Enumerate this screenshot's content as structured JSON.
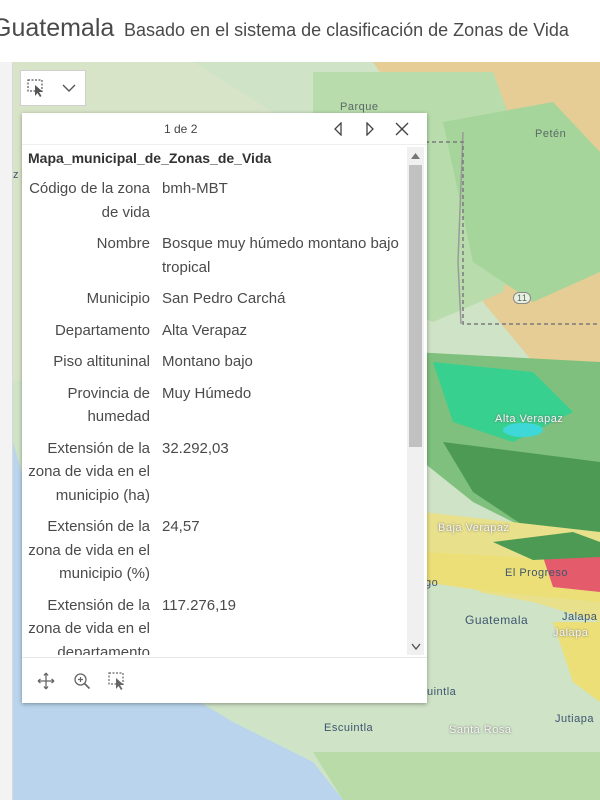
{
  "header": {
    "title": "Guatemala",
    "subtitle": "Basado en el sistema de clasificación de Zonas de Vida"
  },
  "map_tools": [
    {
      "name": "select-tool",
      "icon": "select-cursor-icon"
    },
    {
      "name": "dropdown",
      "icon": "chevron-down-icon"
    }
  ],
  "map_labels": {
    "parque": "Parque",
    "peten": "Petén",
    "route": "11",
    "alta_verapaz": "Alta Verapaz",
    "baja_verapaz": "Baja Verapaz",
    "el_progreso": "El Progreso",
    "guatemala": "Guatemala",
    "jalapa": "Jalapa",
    "jalapa2": "Jalapa",
    "escuintla": "Escuintla",
    "escuintla_partial": "uintla",
    "santa_rosa": "Santa Rosa",
    "jutiapa": "Jutiapa",
    "go_partial": "go",
    "z_partial": "z"
  },
  "popup": {
    "pager": "1 de 2",
    "title": "Mapa_municipal_de_Zonas_de_Vida",
    "attributes": [
      {
        "label": "Código de la zona de vida",
        "value": "bmh-MBT"
      },
      {
        "label": "Nombre",
        "value": "Bosque muy húmedo montano bajo tropical"
      },
      {
        "label": "Municipio",
        "value": "San Pedro Carchá"
      },
      {
        "label": "Departamento",
        "value": "Alta Verapaz"
      },
      {
        "label": "Piso altituninal",
        "value": "Montano bajo"
      },
      {
        "label": "Provincia de humedad",
        "value": "Muy Húmedo"
      },
      {
        "label": "Extensión de la zona de vida en el municipio (ha)",
        "value": "32.292,03"
      },
      {
        "label": "Extensión de la zona de vida en el municipio (%)",
        "value": "24,57"
      },
      {
        "label": "Extensión de la zona de vida en el departamento",
        "value": "117.276,19"
      }
    ],
    "footer_tools": [
      {
        "name": "pan-icon"
      },
      {
        "name": "zoom-in-icon"
      },
      {
        "name": "select-cursor-icon"
      }
    ]
  },
  "colors": {
    "map_base": "#cfe3c6",
    "forest_dark": "#4c9a53",
    "forest_mid": "#7fc07e",
    "forest_light": "#b5dbae",
    "teal": "#38d08e",
    "yellow": "#ecdf77",
    "orange": "#e9c98c",
    "red": "#e45b6b",
    "lake": "#3fd8d8"
  }
}
